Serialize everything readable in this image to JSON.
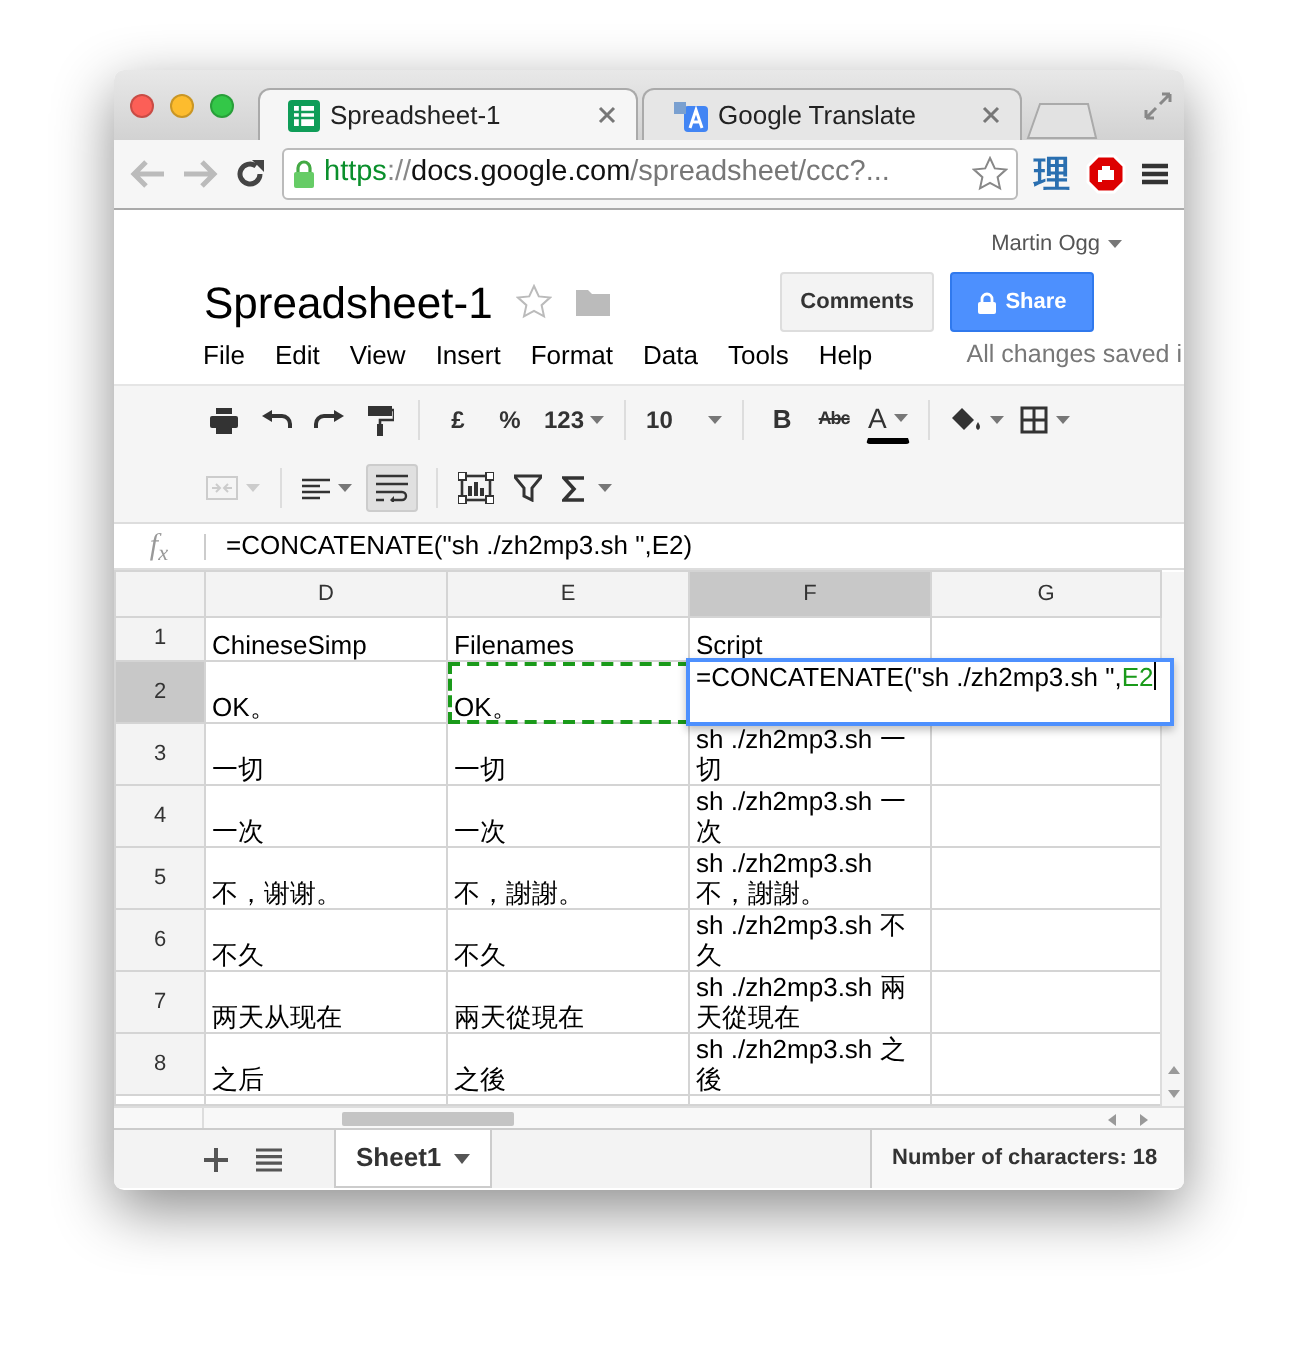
{
  "browser": {
    "tabs": [
      {
        "title": "Spreadsheet-1",
        "kind": "sheets",
        "selected": true
      },
      {
        "title": "Google Translate",
        "kind": "translate",
        "selected": false
      }
    ],
    "url": {
      "scheme": "https",
      "separator": "://",
      "host": "docs.google.com",
      "path": "/spreadsheet/ccc?..."
    },
    "extension_label": "理"
  },
  "document": {
    "title": "Spreadsheet-1",
    "starred": false,
    "user": "Martin Ogg",
    "comments_button": "Comments",
    "share_button": "Share",
    "menu": [
      "File",
      "Edit",
      "View",
      "Insert",
      "Format",
      "Data",
      "Tools",
      "Help"
    ],
    "save_status": "All changes saved i"
  },
  "toolbar": {
    "currency": "£",
    "percent": "%",
    "number_format": "123",
    "font_size": "10",
    "bold": "B",
    "strikethrough": "Abc",
    "text_color": "A",
    "merge_disabled": true,
    "wrap_selected": true
  },
  "formula_bar": {
    "label": "f$_{x}$",
    "formula": "=CONCATENATE(\"sh ./zh2mp3.sh \",E2)"
  },
  "grid": {
    "columns": [
      {
        "label": "D",
        "selected": false
      },
      {
        "label": "E",
        "selected": false
      },
      {
        "label": "F",
        "selected": true
      },
      {
        "label": "G",
        "selected": false
      }
    ],
    "rows": [
      {
        "number": "1",
        "selected": false,
        "cells": [
          {
            "kind": "text",
            "text": "ChineseSimp"
          },
          {
            "kind": "text",
            "text": "Filenames"
          },
          {
            "kind": "text",
            "text": "Script"
          }
        ]
      },
      {
        "number": "2",
        "selected": true,
        "cells": [
          {
            "kind": "text",
            "text": "OK。"
          },
          {
            "kind": "copy_source",
            "text": "OK。"
          },
          {
            "kind": "editor",
            "text": "=CONCATENATE(\"sh ./zh2mp3.sh \",",
            "reference": "E2"
          }
        ]
      },
      {
        "number": "3",
        "selected": false,
        "cells": [
          {
            "kind": "text",
            "text": "一切"
          },
          {
            "kind": "text",
            "text": "一切"
          },
          {
            "kind": "text",
            "text": "sh ./zh2mp3.sh 一切"
          }
        ]
      },
      {
        "number": "4",
        "selected": false,
        "cells": [
          {
            "kind": "text",
            "text": "一次"
          },
          {
            "kind": "text",
            "text": "一次"
          },
          {
            "kind": "text",
            "text": "sh ./zh2mp3.sh 一次"
          }
        ]
      },
      {
        "number": "5",
        "selected": false,
        "cells": [
          {
            "kind": "text",
            "text": "不，谢谢。"
          },
          {
            "kind": "text",
            "text": "不，謝謝。"
          },
          {
            "kind": "text",
            "text": "sh ./zh2mp3.sh 不，謝謝。"
          }
        ]
      },
      {
        "number": "6",
        "selected": false,
        "cells": [
          {
            "kind": "text",
            "text": "不久"
          },
          {
            "kind": "text",
            "text": "不久"
          },
          {
            "kind": "text",
            "text": "sh ./zh2mp3.sh 不久"
          }
        ]
      },
      {
        "number": "7",
        "selected": false,
        "cells": [
          {
            "kind": "text",
            "text": "两天从现在"
          },
          {
            "kind": "text",
            "text": "兩天從現在"
          },
          {
            "kind": "text",
            "text": "sh ./zh2mp3.sh 兩天從現在"
          }
        ]
      },
      {
        "number": "8",
        "selected": false,
        "cells": [
          {
            "kind": "text",
            "text": "之后"
          },
          {
            "kind": "text",
            "text": "之後"
          },
          {
            "kind": "text",
            "text": "sh ./zh2mp3.sh 之後"
          }
        ]
      }
    ]
  },
  "sheets": [
    {
      "name": "Sheet1",
      "selected": true
    }
  ],
  "status": "Number of characters: 18"
}
